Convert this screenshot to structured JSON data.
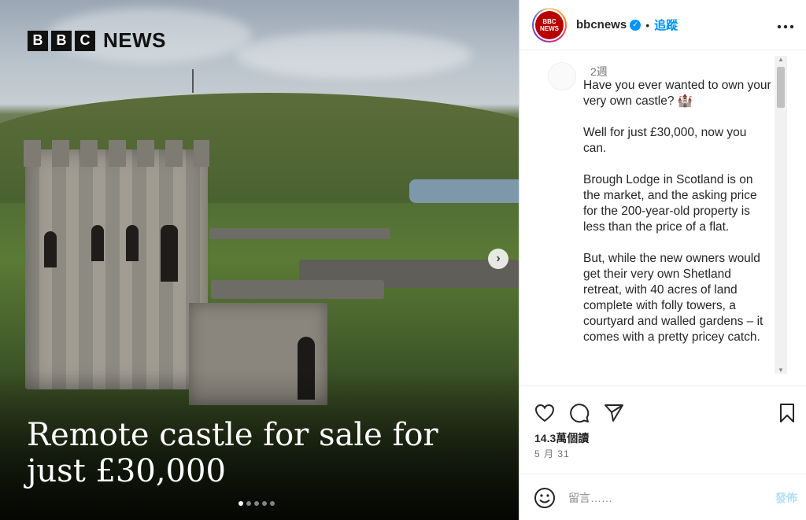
{
  "media": {
    "logo": {
      "boxes": [
        "B",
        "B",
        "C"
      ],
      "word": "NEWS"
    },
    "headline_line1": "Remote castle for sale for",
    "headline_line2": "just £30,000",
    "carousel": {
      "total": 5,
      "active": 1
    }
  },
  "header": {
    "avatar_text_top": "BBC",
    "avatar_text_bottom": "NEWS",
    "username": "bbcnews",
    "separator": "•",
    "follow_label": "追蹤",
    "more_label": "•••"
  },
  "caption": {
    "time": "2週",
    "text": "Have you ever wanted to own your very own castle? 🏰\n\nWell for just £30,000, now you can.\n\nBrough Lodge in Scotland is on the market, and the asking price for the 200-year-old property is less than the price of a flat.\n\nBut, while the new owners would get their very own Shetland retreat, with 40 acres of land complete with folly towers, a courtyard and walled gardens – it comes with a pretty pricey catch."
  },
  "stats": {
    "views": "14.3萬個讀",
    "date": "5 月 31"
  },
  "comment": {
    "placeholder": "留言……",
    "post_label": "發佈"
  },
  "colors": {
    "accent": "#0095f6",
    "bbc_red": "#b80000"
  }
}
